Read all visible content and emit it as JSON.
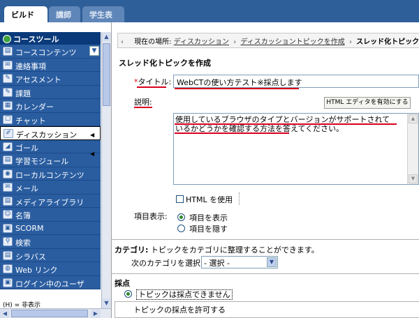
{
  "tabs": {
    "build": "ビルド",
    "instructor": "講師",
    "student_view": "学生表示"
  },
  "sidebar": {
    "header": "コースツール",
    "items": [
      {
        "label": "コースコンテンツ",
        "icon": "course-content-icon",
        "glyph": "▤"
      },
      {
        "label": "連絡事項",
        "icon": "announcement-icon",
        "glyph": "✉"
      },
      {
        "label": "アセスメント",
        "icon": "assessment-icon",
        "glyph": "✎"
      },
      {
        "label": "課題",
        "icon": "assignment-icon",
        "glyph": "✎"
      },
      {
        "label": "カレンダー",
        "icon": "calendar-icon",
        "glyph": "▦"
      },
      {
        "label": "チャット",
        "icon": "chat-icon",
        "glyph": "☐"
      },
      {
        "label": "ディスカッション",
        "icon": "discussion-icon",
        "glyph": "✐"
      },
      {
        "label": "ゴール",
        "icon": "goal-icon",
        "glyph": "◢"
      },
      {
        "label": "学習モジュール",
        "icon": "learning-module-icon",
        "glyph": "▤"
      },
      {
        "label": "ローカルコンテンツ",
        "icon": "local-content-icon",
        "glyph": "◉"
      },
      {
        "label": "メール",
        "icon": "mail-icon",
        "glyph": "✉"
      },
      {
        "label": "メディアライブラリ",
        "icon": "media-library-icon",
        "glyph": "▤"
      },
      {
        "label": "名簿",
        "icon": "roster-icon",
        "glyph": "☺"
      },
      {
        "label": "SCORM",
        "icon": "scorm-icon",
        "glyph": "▣"
      },
      {
        "label": "検索",
        "icon": "search-icon",
        "glyph": "⚲"
      },
      {
        "label": "シラバス",
        "icon": "syllabus-icon",
        "glyph": "▤"
      },
      {
        "label": "Web リンク",
        "icon": "web-link-icon",
        "glyph": "◍"
      },
      {
        "label": "ログイン中のユーザ",
        "icon": "logged-in-users-icon",
        "glyph": "▣"
      }
    ],
    "active_index": 6,
    "footer": "(H) = 非表示"
  },
  "breadcrumb": {
    "prefix": "現在の場所:",
    "links": [
      "ディスカッション",
      "ディスカッショントピックを作成"
    ],
    "current": "スレッド化トピックを作"
  },
  "form": {
    "page_title": "スレッド化トピックを作成",
    "title_required_mark": "*",
    "title_label": "タイトル:",
    "title_value": "WebCTの使い方テスト※採点します",
    "desc_label": "説明:",
    "html_editor_button": "HTML エディタを有効にする",
    "desc_value": "使用しているブラウザのタイプとバージョンがサポートされているかどうかを確認する方法を答えてください。",
    "use_html_label": "HTML を使用",
    "display_label": "項目表示:",
    "display_options": [
      "項目を表示",
      "項目を隠す"
    ],
    "category_heading": "カテゴリ:",
    "category_desc": " トピックをカテゴリに整理することができます。",
    "category_select_label": "次のカテゴリを選択:",
    "category_select_value": "- 選択 -",
    "grading_heading": "採点",
    "grading_option": "トピックは採点できません",
    "grading_allow": "トピックの採点を許可する"
  },
  "colors": {
    "topbar": "#2f5f98",
    "sidebar_item": "#2a5da0",
    "required": "#dd0000",
    "annotation_underline": "#d8001e"
  }
}
